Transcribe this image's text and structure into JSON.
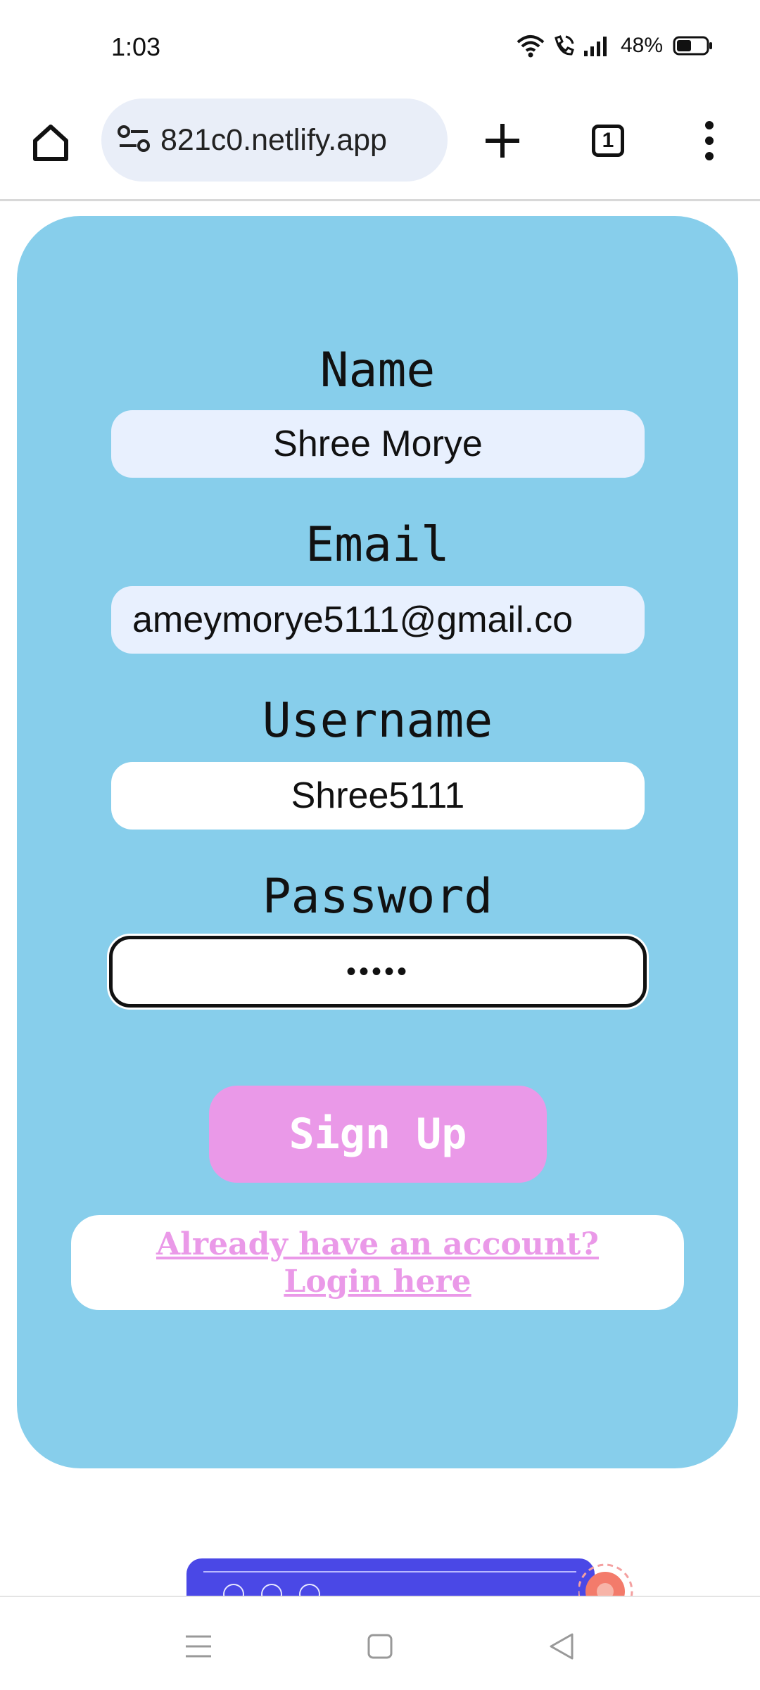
{
  "status_bar": {
    "time": "1:03",
    "battery_percent": "48%"
  },
  "browser": {
    "url": "821c0.netlify.app",
    "tab_count": "1"
  },
  "form": {
    "name_label": "Name",
    "name_value": "Shree Morye",
    "email_label": "Email",
    "email_value": "ameymorye5111@gmail.co",
    "username_label": "Username",
    "username_value": "Shree5111",
    "password_label": "Password",
    "password_value": "•••••",
    "signup_label": "Sign Up",
    "login_link": "Already have an account? Login here"
  },
  "colors": {
    "card_bg": "#87ceeb",
    "button_pink": "#ea99e8",
    "autofill_bg": "#e8f0fe",
    "peek_blue": "#4a48e6"
  }
}
